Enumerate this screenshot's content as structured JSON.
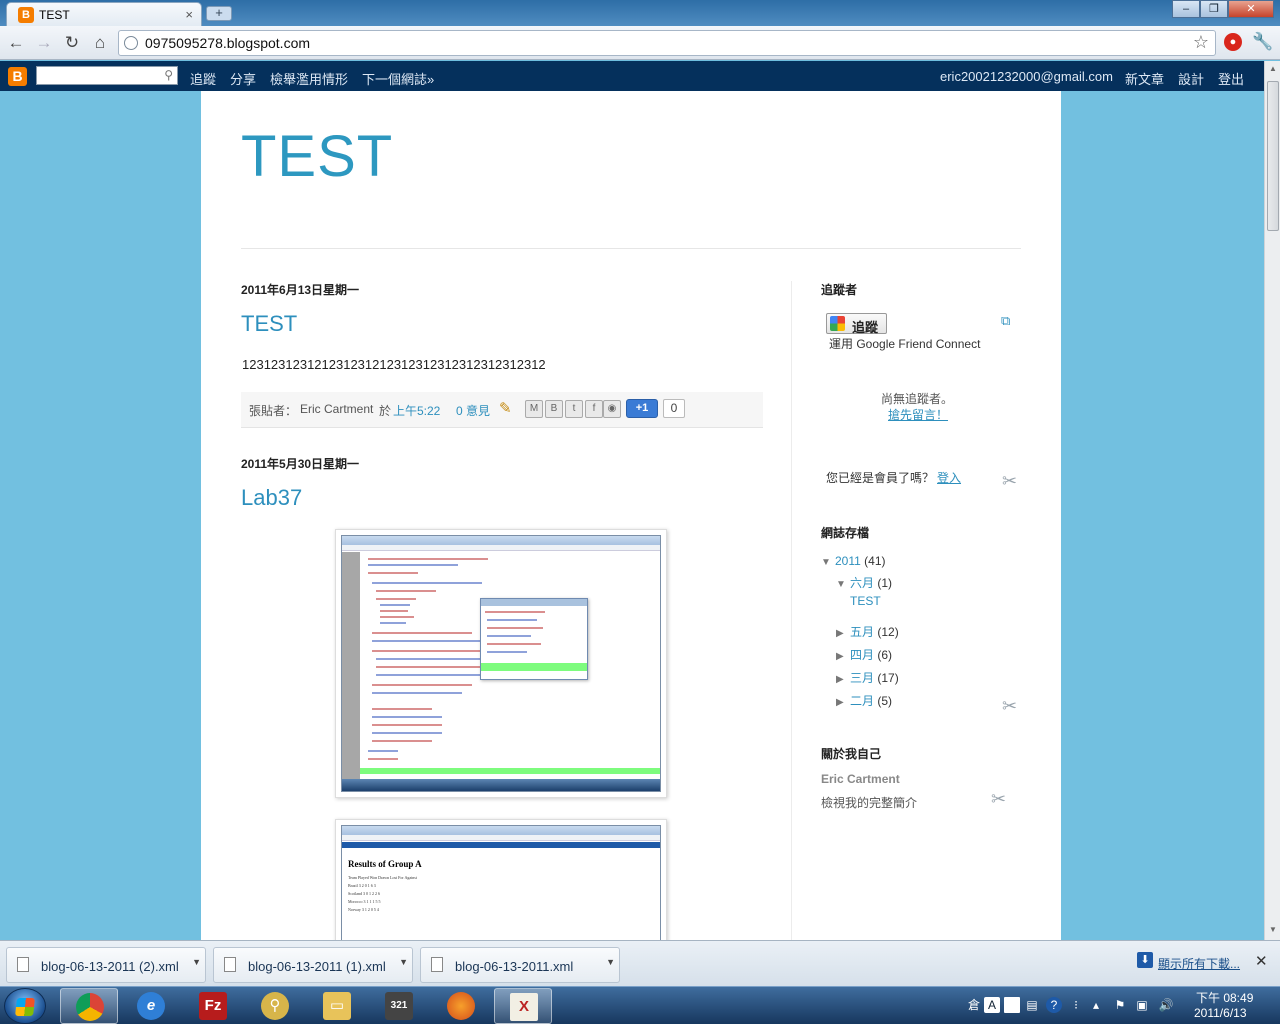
{
  "browser": {
    "tab_title": "TEST",
    "tab_close": "×",
    "new_tab": "+",
    "url": "0975095278.blogspot.com"
  },
  "navbar": {
    "links": [
      "追蹤",
      "分享",
      "檢舉濫用情形",
      "下一個網誌»"
    ],
    "user_email": "eric20021232000@gmail.com",
    "right_links": [
      "新文章",
      "設計",
      "登出"
    ]
  },
  "blog": {
    "title": "TEST",
    "posts": [
      {
        "date": "2011年6月13日星期一",
        "title": "TEST",
        "body": "123123123121231231212312312312312312312312",
        "footer_label": "張貼者：",
        "author": "Eric Cartment",
        "at": "於",
        "time": "上午5:22",
        "comments": "0 意見",
        "plus_one": "+1",
        "plus_one_count": "0"
      },
      {
        "date": "2011年5月30日星期一",
        "title": "Lab37",
        "screenshot2_heading": "Results of Group A",
        "screenshot2_table": [
          [
            "Team",
            "Played",
            "Won",
            "Drawn",
            "Lost",
            "For",
            "Against"
          ],
          [
            "Brazil",
            "3",
            "2",
            "0",
            "1",
            "6",
            "3"
          ],
          [
            "Scotland",
            "3",
            "0",
            "1",
            "2",
            "2",
            "6"
          ],
          [
            "Morocco",
            "3",
            "1",
            "1",
            "1",
            "5",
            "5"
          ],
          [
            "Norway",
            "3",
            "1",
            "2",
            "0",
            "5",
            "4"
          ]
        ]
      }
    ]
  },
  "sidebar": {
    "followers_heading": "追蹤者",
    "follow_button": "追蹤",
    "gfc_text": "運用 Google Friend Connect",
    "no_followers": "尚無追蹤者。",
    "be_first": "搶先留言！",
    "member_q": "您已經是會員了嗎？",
    "sign_in": "登入",
    "archive_heading": "網誌存檔",
    "archive": {
      "year": "2011",
      "year_count": "(41)",
      "open_month": "六月",
      "open_month_count": "(1)",
      "open_month_post": "TEST",
      "months": [
        {
          "label": "五月",
          "count": "(12)"
        },
        {
          "label": "四月",
          "count": "(6)"
        },
        {
          "label": "三月",
          "count": "(17)"
        },
        {
          "label": "二月",
          "count": "(5)"
        }
      ]
    },
    "about_heading": "關於我自己",
    "about_name": "Eric Cartment",
    "about_profile": "檢視我的完整簡介"
  },
  "downloads": {
    "items": [
      "blog-06-13-2011 (2).xml",
      "blog-06-13-2011 (1).xml",
      "blog-06-13-2011.xml"
    ],
    "show_all": "顯示所有下載..."
  },
  "taskbar": {
    "time": "下午 08:49",
    "date": "2011/6/13"
  },
  "colors": {
    "accent": "#2d98c0",
    "navbar": "#05305c",
    "page_bg": "#72c0e0"
  }
}
